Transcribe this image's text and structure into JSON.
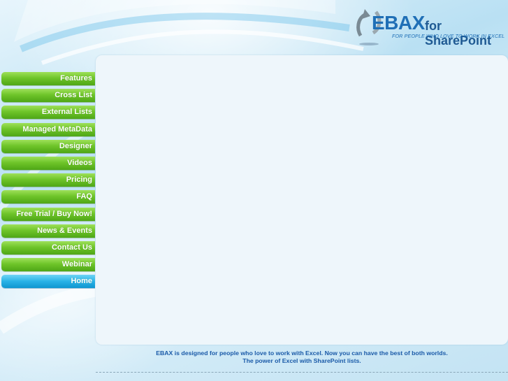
{
  "logo": {
    "main": "EBAX",
    "for": "for SharePoint",
    "tagline": "FOR PEOPLE WHO LOVE TO WORK IN EXCEL"
  },
  "nav": {
    "items": [
      {
        "label": "Features"
      },
      {
        "label": "Cross List"
      },
      {
        "label": "External Lists"
      },
      {
        "label": "Managed MetaData"
      },
      {
        "label": "Designer"
      },
      {
        "label": "Videos"
      },
      {
        "label": "Pricing"
      },
      {
        "label": "FAQ"
      },
      {
        "label": "Free Trial / Buy Now!"
      },
      {
        "label": "News & Events"
      },
      {
        "label": "Contact Us"
      },
      {
        "label": "Webinar"
      },
      {
        "label": "Home"
      }
    ],
    "active": "Home"
  },
  "footer": {
    "line1": "EBAX is designed for people who love to work with Excel. Now you can have the best of both worlds.",
    "line2": "The power of Excel with SharePoint lists."
  },
  "colors": {
    "nav_green": "#6fc52a",
    "nav_active_blue": "#29b2e6",
    "brand_blue": "#1f6fb6",
    "footer_text": "#1a5aa8"
  }
}
